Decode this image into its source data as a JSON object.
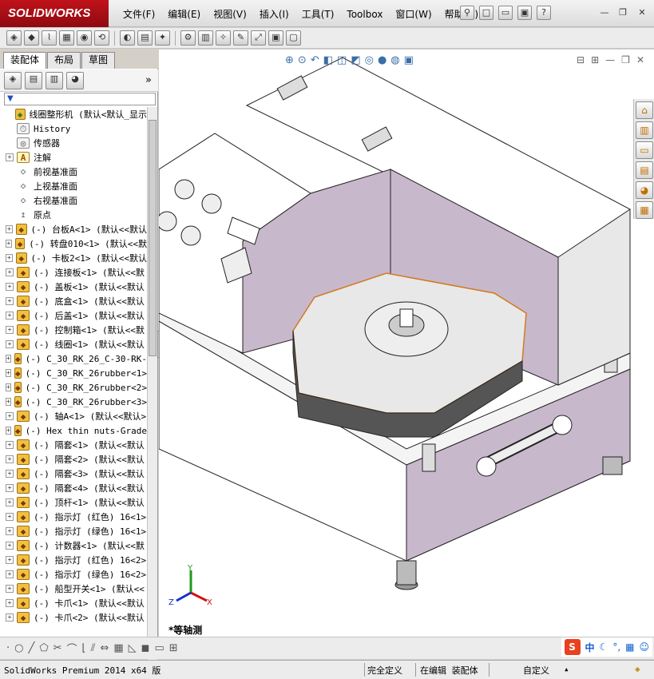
{
  "title_bar": {
    "logo_text": "SOLIDWORKS",
    "menus": [
      "文件(F)",
      "编辑(E)",
      "视图(V)",
      "插入(I)",
      "工具(T)",
      "Toolbox",
      "窗口(W)",
      "帮助(H)"
    ]
  },
  "left_panel": {
    "tabs": [
      "装配体",
      "布局",
      "草图"
    ],
    "active_tab": "装配体",
    "tree": [
      {
        "label": "线圈整形机  (默认<默认_显示",
        "icon": "assembly",
        "expander": "none"
      },
      {
        "label": "History",
        "icon": "history",
        "expander": "none"
      },
      {
        "label": "传感器",
        "icon": "sensor",
        "expander": "none"
      },
      {
        "label": "注解",
        "icon": "annotation",
        "expander": "+"
      },
      {
        "label": "前视基准面",
        "icon": "plane",
        "expander": "none"
      },
      {
        "label": "上视基准面",
        "icon": "plane",
        "expander": "none"
      },
      {
        "label": "右视基准面",
        "icon": "plane",
        "expander": "none"
      },
      {
        "label": "原点",
        "icon": "origin",
        "expander": "none"
      },
      {
        "label": "(-) 台板A<1> (默认<<默认",
        "icon": "part",
        "expander": "+"
      },
      {
        "label": "(-) 转盘010<1> (默认<<默",
        "icon": "part",
        "expander": "+"
      },
      {
        "label": "(-) 卡板2<1> (默认<<默认",
        "icon": "part",
        "expander": "+"
      },
      {
        "label": "(-) 连接板<1> (默认<<默",
        "icon": "part",
        "expander": "+"
      },
      {
        "label": "(-) 盖板<1> (默认<<默认",
        "icon": "part",
        "expander": "+"
      },
      {
        "label": "(-) 底盒<1> (默认<<默认",
        "icon": "part",
        "expander": "+"
      },
      {
        "label": "(-) 后盖<1> (默认<<默认",
        "icon": "part",
        "expander": "+"
      },
      {
        "label": "(-) 控制箱<1> (默认<<默",
        "icon": "part",
        "expander": "+"
      },
      {
        "label": "(-) 线圈<1> (默认<<默认",
        "icon": "part",
        "expander": "+"
      },
      {
        "label": "(-) C_30_RK_26_C-30-RK-",
        "icon": "part",
        "expander": "+"
      },
      {
        "label": "(-) C_30_RK_26rubber<1>",
        "icon": "part",
        "expander": "+"
      },
      {
        "label": "(-) C_30_RK_26rubber<2>",
        "icon": "part",
        "expander": "+"
      },
      {
        "label": "(-) C_30_RK_26rubber<3>",
        "icon": "part",
        "expander": "+"
      },
      {
        "label": "(-) 轴A<1> (默认<<默认>",
        "icon": "part",
        "expander": "+"
      },
      {
        "label": "(-) Hex thin nuts-Grade",
        "icon": "part",
        "expander": "+"
      },
      {
        "label": "(-) 隔套<1> (默认<<默认",
        "icon": "part",
        "expander": "+"
      },
      {
        "label": "(-) 隔套<2> (默认<<默认",
        "icon": "part",
        "expander": "+"
      },
      {
        "label": "(-) 隔套<3> (默认<<默认",
        "icon": "part",
        "expander": "+"
      },
      {
        "label": "(-) 隔套<4> (默认<<默认",
        "icon": "part",
        "expander": "+"
      },
      {
        "label": "(-) 顶杆<1> (默认<<默认",
        "icon": "part",
        "expander": "+"
      },
      {
        "label": "(-) 指示灯 (红色) 16<1>",
        "icon": "part",
        "expander": "+"
      },
      {
        "label": "(-) 指示灯 (绿色) 16<1>",
        "icon": "part",
        "expander": "+"
      },
      {
        "label": "(-) 计数器<1> (默认<<默",
        "icon": "part",
        "expander": "+"
      },
      {
        "label": "(-) 指示灯 (红色) 16<2>",
        "icon": "part",
        "expander": "+"
      },
      {
        "label": "(-) 指示灯 (绿色) 16<2>",
        "icon": "part",
        "expander": "+"
      },
      {
        "label": "(-) 船型开关<1> (默认<<",
        "icon": "part",
        "expander": "+"
      },
      {
        "label": "(-) 卡爪<1> (默认<<默认",
        "icon": "part",
        "expander": "+"
      },
      {
        "label": "(-) 卡爪<2> (默认<<默认",
        "icon": "part",
        "expander": "+"
      }
    ]
  },
  "viewport": {
    "view_name": "*等轴测",
    "triad": {
      "x": "X",
      "y": "Y",
      "z": "Z"
    }
  },
  "status_bar": {
    "product": "SolidWorks Premium 2014 x64 版",
    "definition": "完全定义",
    "mode": "在编辑 装配体",
    "units": "自定义"
  },
  "ime": {
    "lang": "中"
  },
  "colors": {
    "housing": "#c8b8cc",
    "accent": "#c1121a",
    "plate_edge": "#d07a20"
  }
}
